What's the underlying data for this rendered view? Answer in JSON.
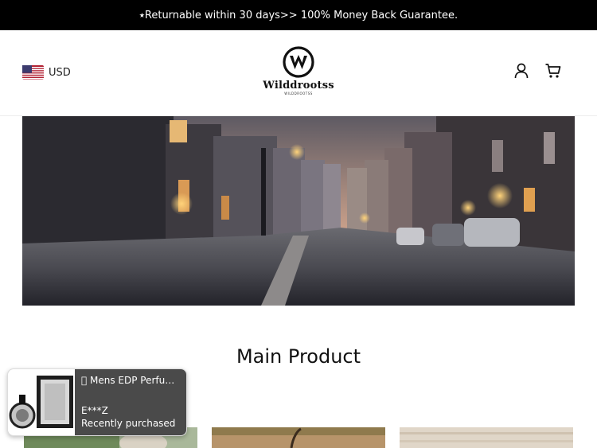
{
  "announcement": {
    "text": "⭑Returnable within 30 days>> 100% Money Back Guarantee."
  },
  "header": {
    "currency": {
      "code": "USD",
      "flag_icon": "us-flag-icon"
    },
    "logo": {
      "name": "Wilddrootss",
      "subtitle": "WILDDROOTSS",
      "icon": "w-logo-icon"
    },
    "icons": [
      "account-icon",
      "cart-icon"
    ]
  },
  "hero": {
    "image": "city-cobblestone-street-dusk"
  },
  "main": {
    "section_title": "Main Product"
  },
  "popup": {
    "product_title": "\u0000 Mens EDP Perfum...",
    "buyer": "E***Z",
    "status": "Recently purchased",
    "image": "perfume-bottle-box"
  },
  "colors": {
    "announcement_bg": "#000000",
    "popup_bg": "#4a4a4a",
    "text": "#111111"
  }
}
